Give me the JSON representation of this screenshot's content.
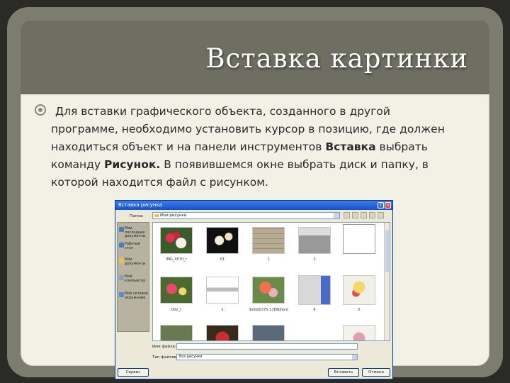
{
  "slide": {
    "title": "Вставка картинки",
    "bullet": {
      "line1": "Для вставки графического объекта, созданного в другой",
      "line2": "программе, необходимо установить курсор в позицию, где должен",
      "line3_a": "находиться объект и  на панели инструментов ",
      "line3_b": "Вставка",
      "line3_c": " выбрать",
      "line4_a": "команду ",
      "line4_b": "Рисунок.",
      "line4_c": " В  появившемся окне выбрать диск и папку, в",
      "line5": "которой находится файл с рисунком."
    }
  },
  "dialog": {
    "title": "Вставка рисунка",
    "lookin_label": "Папка:",
    "lookin_value": "Мои рисунки",
    "places": [
      "Мои последние документы",
      "Рабочий стол",
      "Мои документы",
      "Мой компьютер",
      "Моё сетевое окружение"
    ],
    "files": [
      "IMG_4570_r",
      "01",
      "1",
      "3",
      "",
      "002_r",
      "2",
      "3eddd1f75-1789bfacd",
      "4",
      "5"
    ],
    "filename_label": "Имя файла:",
    "filetype_label": "Тип файлов:",
    "filetype_value": "Все рисунки",
    "service_button": "Сервис",
    "insert_button": "Вставить",
    "cancel_button": "Отмена"
  },
  "colors": {
    "frame": "#7c7d6e",
    "title_bar": "#6e6f62",
    "content_bg": "#f2f1e6",
    "dialog_titlebar": "#1451c9"
  }
}
